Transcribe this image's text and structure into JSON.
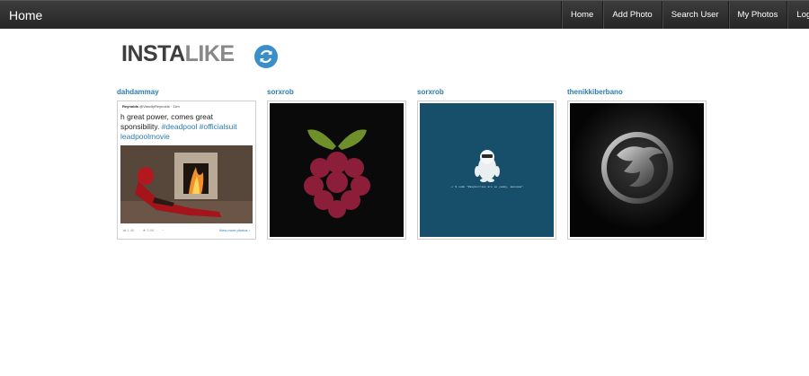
{
  "navbar": {
    "brand": "Home",
    "items": [
      "Home",
      "Add Photo",
      "Search User",
      "My Photos",
      "Log out"
    ]
  },
  "logo": {
    "bold": "INSTA",
    "light": "LIKE"
  },
  "cards": [
    {
      "username": "dahdammay",
      "tweet": {
        "author": "Reynolds",
        "handle": "@VancityReynolds · 11m",
        "line1": "h great power, comes great",
        "line2_text": "sponsibility. ",
        "line2_tags": "#deadpool #officialsuit",
        "line3_tag": "leadpoolmovie",
        "retweets": "1.4K",
        "likes": "3.9K",
        "more": "View more photos ›"
      }
    },
    {
      "username": "sorxrob"
    },
    {
      "username": "sorxrob",
      "caption": "~/ $ sudo \"Raspberries are so yummy, awesome\""
    },
    {
      "username": "thenikkiberbano"
    }
  ],
  "colors": {
    "navbar": "#2e2e2e",
    "username_link": "#2a7bb3",
    "logo_badge": "#3a8fc8",
    "teal_background": "#174e6a",
    "raspberry_red": "#8c1e3a",
    "raspberry_leaf": "#6f8f2a"
  },
  "icons": {
    "logo": "refresh-circle-icon",
    "card2": "raspberry-pi-logo",
    "card3": "yeti-mascot",
    "card4": "dragon-emblem",
    "retweet": "retweet-icon",
    "like": "star-icon",
    "more": "ellipsis-icon"
  }
}
